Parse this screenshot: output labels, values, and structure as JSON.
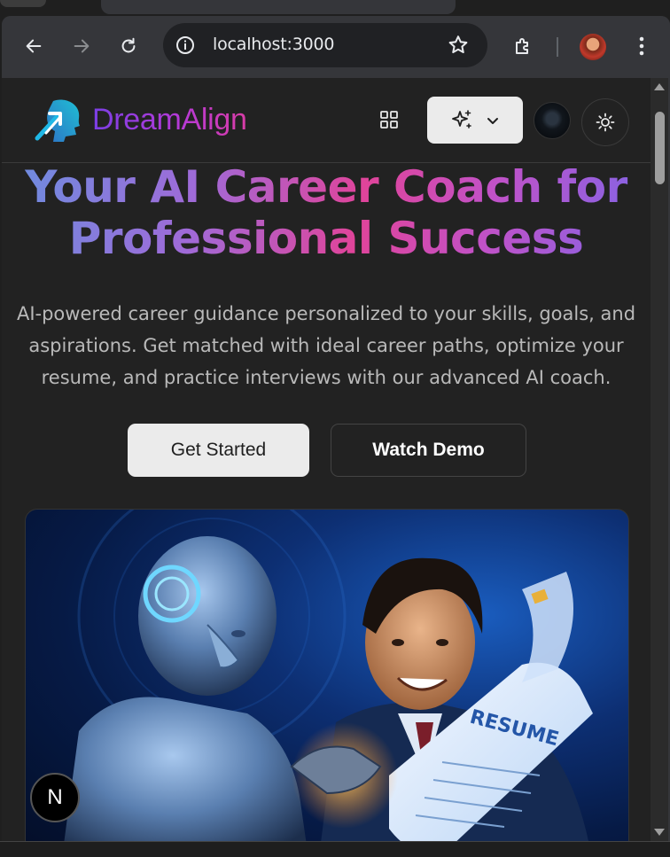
{
  "browser": {
    "url": "localhost:3000",
    "icons": [
      "back-arrow-icon",
      "forward-arrow-icon",
      "reload-icon",
      "site-info-icon",
      "bookmark-star-icon",
      "extensions-icon",
      "profile-avatar",
      "kebab-menu-icon"
    ]
  },
  "site": {
    "brand": "DreamAlign",
    "brand_colors": [
      "#7b3fe4",
      "#b43ad8",
      "#d93ca6"
    ],
    "logo_colors": [
      "#1fb8e6",
      "#2e7dd8"
    ]
  },
  "hero": {
    "title_line1": "Your AI Career Coach for",
    "title_line2": "Professional Success",
    "subtitle": "AI-powered career guidance personalized to your skills, goals, and aspirations. Get matched with ideal career paths, optimize your resume, and practice interviews with our advanced AI coach.",
    "primary_cta": "Get Started",
    "secondary_cta": "Watch Demo",
    "image_resume_text": "RESUME"
  },
  "dev_badge": "N",
  "colors": {
    "background": "#222222",
    "title_gradient": [
      "#6a8fe0",
      "#e0449a",
      "#7e66e8"
    ],
    "primary_button": "#ebebeb"
  }
}
